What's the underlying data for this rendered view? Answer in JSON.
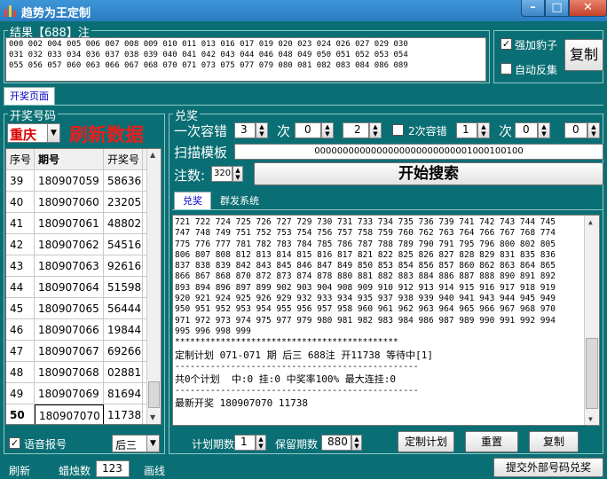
{
  "window": {
    "title": "趋势为王定制",
    "controls": {
      "min": "–",
      "max": "□",
      "close": "✕"
    }
  },
  "result": {
    "group_label": "结果【688】注",
    "lines": [
      "000 002 004 005 006 007 008 009 010 011 013 016 017 019 020 023 024 026 027 029 030",
      "031 032 033 034 036 037 038 039 040 041 042 043 044 046 048 049 050 051 052 053 054",
      "055 056 057 060 063 066 067 068 070 071 073 075 077 079 080 081 082 083 084 086 089"
    ],
    "chk_force": {
      "label": "强加豹子",
      "checked": true
    },
    "chk_auto": {
      "label": "自动反集",
      "checked": false
    },
    "copy_label": "复制"
  },
  "main_tab": {
    "label": "开奖页面"
  },
  "draw": {
    "group_label": "开奖号码",
    "region": "重庆",
    "refresh_label": "刷新数据",
    "columns": [
      "序号",
      "期号",
      "开奖号"
    ],
    "rows": [
      {
        "idx": "39",
        "period": "180907059",
        "num": "58636"
      },
      {
        "idx": "40",
        "period": "180907060",
        "num": "23205"
      },
      {
        "idx": "41",
        "period": "180907061",
        "num": "48802"
      },
      {
        "idx": "42",
        "period": "180907062",
        "num": "54516"
      },
      {
        "idx": "43",
        "period": "180907063",
        "num": "92616"
      },
      {
        "idx": "44",
        "period": "180907064",
        "num": "51598"
      },
      {
        "idx": "45",
        "period": "180907065",
        "num": "56444"
      },
      {
        "idx": "46",
        "period": "180907066",
        "num": "19844"
      },
      {
        "idx": "47",
        "period": "180907067",
        "num": "69266"
      },
      {
        "idx": "48",
        "period": "180907068",
        "num": "02881"
      },
      {
        "idx": "49",
        "period": "180907069",
        "num": "81694"
      },
      {
        "idx": "50",
        "period": "180907070",
        "num": "11738"
      }
    ],
    "voice_label": "语音报号",
    "voice_checked": true,
    "position_value": "后三"
  },
  "prize": {
    "group_label": "兑奖",
    "tolerance1_label": "一次容错",
    "tolerance1_value": "3",
    "times_label": "次",
    "times1a": "0",
    "times1b": "2",
    "tolerance2_label": "2次容错",
    "tolerance2_value": "1",
    "times2a": "0",
    "times2b": "0",
    "scan_label": "扫描模板",
    "scan_value": "0000000000000000000000000001000100100",
    "count_label": "注数:",
    "count_value": "320",
    "search_label": "开始搜索",
    "tabs": [
      "兑奖",
      "群发系统"
    ],
    "output_lines": [
      "721 722 724 725 726 727 729 730 731 733 734 735 736 739 741 742 743 744 745",
      "747 748 749 751 752 753 754 756 757 758 759 760 762 763 764 766 767 768 774",
      "775 776 777 781 782 783 784 785 786 787 788 789 790 791 795 796 800 802 805",
      "806 807 808 812 813 814 815 816 817 821 822 825 826 827 828 829 831 835 836",
      "837 838 839 842 843 845 846 847 849 850 853 854 856 857 860 862 863 864 865",
      "866 867 868 870 872 873 874 878 880 881 882 883 884 886 887 888 890 891 892",
      "893 894 896 897 899 902 903 904 908 909 910 912 913 914 915 916 917 918 919",
      "920 921 924 925 926 929 932 933 934 935 937 938 939 940 941 943 944 945 949",
      "950 951 952 953 954 955 956 957 958 960 961 962 963 964 965 966 967 968 970",
      "971 972 973 974 975 977 979 980 981 982 983 984 986 987 989 990 991 992 994",
      "995 996 998 999",
      "********************************************",
      "定制计划 071-071 期 后三 688注 开11738 等待中[1]",
      "------------------------------------------------",
      "共0个计划  中:0 挂:0 中奖率100% 最大连挂:0",
      "------------------------------------------------",
      "最新开奖 180907070 11738"
    ],
    "plan_period_label": "计划期数",
    "plan_period_value": "1",
    "keep_period_label": "保留期数",
    "keep_period_value": "880",
    "custom_plan_label": "定制计划",
    "reset_label": "重置",
    "copy2_label": "复制"
  },
  "status": {
    "refresh": "刷新",
    "candle_label": "蜡烛数",
    "candle_value": "123",
    "line_label": "画线",
    "submit_label": "提交外部号码兑奖"
  }
}
